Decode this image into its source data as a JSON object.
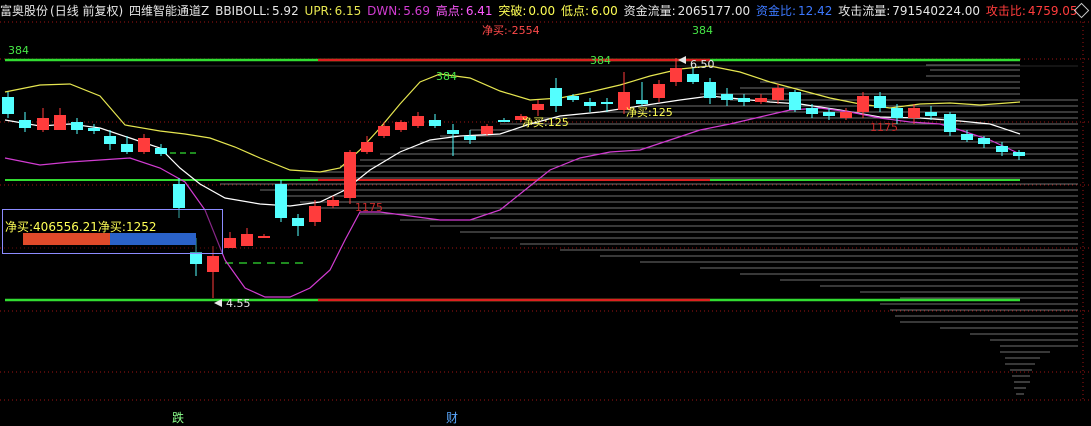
{
  "header": {
    "stock_name": "富奥股份",
    "period": "(日线 前复权)",
    "indicator": "四维智能通道Z",
    "bbiboll_label": "BBIBOLL:",
    "bbiboll_value": "5.92",
    "upr_label": "UPR:",
    "upr_value": "6.15",
    "dwn_label": "DWN:",
    "dwn_value": "5.69",
    "high_label": "高点:",
    "high_value": "6.41",
    "break_label": "突破:",
    "break_value": "0.00",
    "low_label": "低点:",
    "low_value": "6.00",
    "fund_label": "资金流量:",
    "fund_value": "2065177.00",
    "fundratio_label": "资金比:",
    "fundratio_value": "12.42",
    "attack_label": "攻击流量:",
    "attack_value": "791540224.00",
    "attackratio_label": "攻击比:",
    "attackratio_value": "4759.05"
  },
  "annotations": {
    "level_384_top": "384",
    "net_buy_top": "净买:-2554",
    "label_384_mid": "384",
    "label_384_right": "384",
    "label_384_center": "384",
    "high_price": "6.50",
    "net_buy_mid": "净买:125",
    "net_buy_right": "净买:125",
    "level_1175_low": "1175",
    "level_1175_right": "1175",
    "low_price": "4.55"
  },
  "panel": {
    "text": "净买:406556.21净买:1252",
    "buy_fraction": 0.5
  },
  "footer": {
    "signal_up": "跌",
    "signal_cai": "财"
  },
  "colors": {
    "background": "#000000",
    "up_candle": "#ff3c3c",
    "down_candle": "#54ffff",
    "green_line": "#32dc32",
    "red_line": "#dc2020",
    "bbi_line": "#ffffff",
    "upper_band": "#e6e650",
    "lower_band": "#d23cd2",
    "fund_ratio": "#3c78ff",
    "attack_ratio": "#ff3c3c"
  }
}
